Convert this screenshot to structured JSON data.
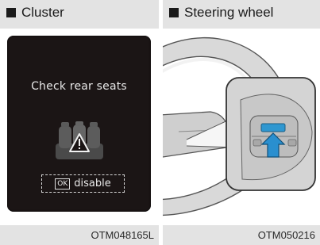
{
  "cluster": {
    "caption": "Cluster",
    "message": "Check rear seats",
    "ok_key": "OK",
    "disable_label": "disable",
    "image_code": "OTM048165L"
  },
  "steering": {
    "caption": "Steering wheel",
    "image_code": "OTM050216"
  },
  "colors": {
    "screen_bg": "#1b1515",
    "button_highlight": "#2f97d0",
    "arrow": "#2a8fcf"
  },
  "icons": [
    "rear-seat-warning-icon",
    "ok-key-icon",
    "press-arrow-icon"
  ]
}
